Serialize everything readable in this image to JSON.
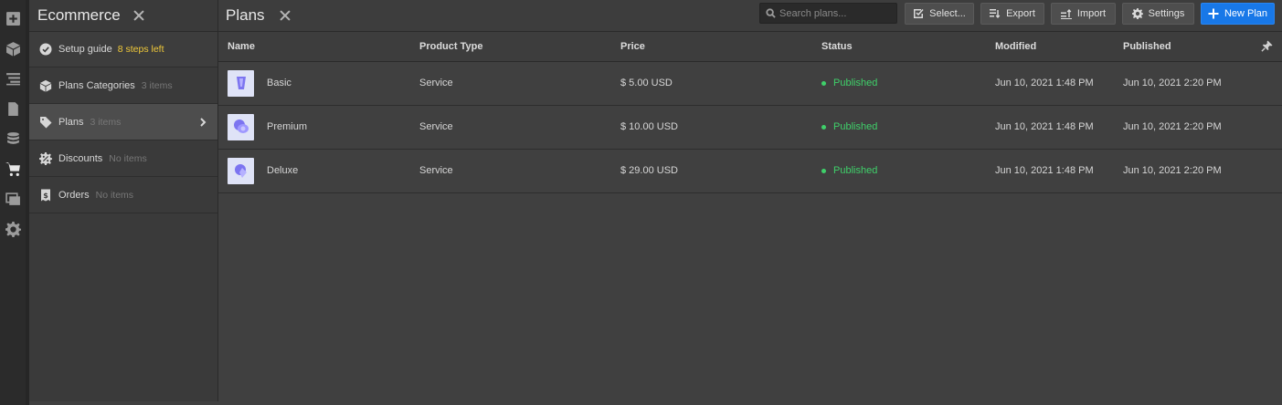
{
  "rail": {
    "icons": [
      "add-icon",
      "box-icon",
      "navigator-icon",
      "pages-icon",
      "cms-icon",
      "ecommerce-cart-icon",
      "assets-icon",
      "settings-gear-icon"
    ],
    "active": "ecommerce-cart-icon"
  },
  "panel": {
    "title": "Ecommerce",
    "items": [
      {
        "label": "Setup guide",
        "extra": "8 steps left",
        "icon": "check-circle-icon"
      },
      {
        "label": "Plans Categories",
        "extra": "3 items",
        "icon": "box-icon"
      },
      {
        "label": "Plans",
        "extra": "3 items",
        "icon": "tag-icon"
      },
      {
        "label": "Discounts",
        "extra": "No items",
        "icon": "discount-icon"
      },
      {
        "label": "Orders",
        "extra": "No items",
        "icon": "receipt-icon"
      }
    ]
  },
  "main": {
    "title": "Plans",
    "search_placeholder": "Search plans...",
    "buttons": {
      "select": "Select...",
      "export": "Export",
      "import": "Import",
      "settings": "Settings",
      "new_plan": "New Plan"
    }
  },
  "table": {
    "columns": [
      "Name",
      "Product Type",
      "Price",
      "Status",
      "Modified",
      "Published"
    ],
    "rows": [
      {
        "name": "Basic",
        "type": "Service",
        "price": "$ 5.00 USD",
        "status": "Published",
        "modified": "Jun 10, 2021 1:48 PM",
        "published": "Jun 10, 2021 2:20 PM"
      },
      {
        "name": "Premium",
        "type": "Service",
        "price": "$ 10.00 USD",
        "status": "Published",
        "modified": "Jun 10, 2021 1:48 PM",
        "published": "Jun 10, 2021 2:20 PM"
      },
      {
        "name": "Deluxe",
        "type": "Service",
        "price": "$ 29.00 USD",
        "status": "Published",
        "modified": "Jun 10, 2021 1:48 PM",
        "published": "Jun 10, 2021 2:20 PM"
      }
    ]
  },
  "colors": {
    "accent": "#1878e8",
    "status_published": "#3fd06a",
    "steps_warning": "#f0c93a"
  }
}
